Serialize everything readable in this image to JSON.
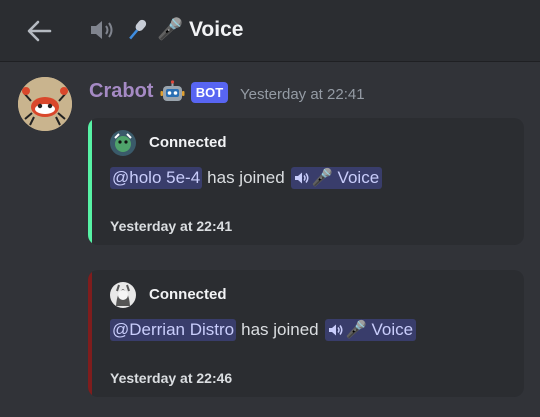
{
  "header": {
    "channel_name": "🎤 Voice",
    "icons": [
      "arrow-left-icon",
      "speaker-muted-icon"
    ]
  },
  "message": {
    "author": "Crabot",
    "author_color": "#a58ac4",
    "emoji": "robot-face-icon",
    "badge": "BOT",
    "badge_color": "#5865f2",
    "timestamp": "Yesterday at 22:41"
  },
  "embeds": [
    {
      "accent": "#57f2a5",
      "author": "Connected",
      "mention": "@holo 5e-4",
      "joined_text": "has joined",
      "channel": "🎤 Voice",
      "footer": "Yesterday at 22:41"
    },
    {
      "accent": "#7f1d1d",
      "author": "Connected",
      "mention": "@Derrian Distro",
      "joined_text": "has joined",
      "channel": "🎤 Voice",
      "footer": "Yesterday at 22:46"
    }
  ]
}
